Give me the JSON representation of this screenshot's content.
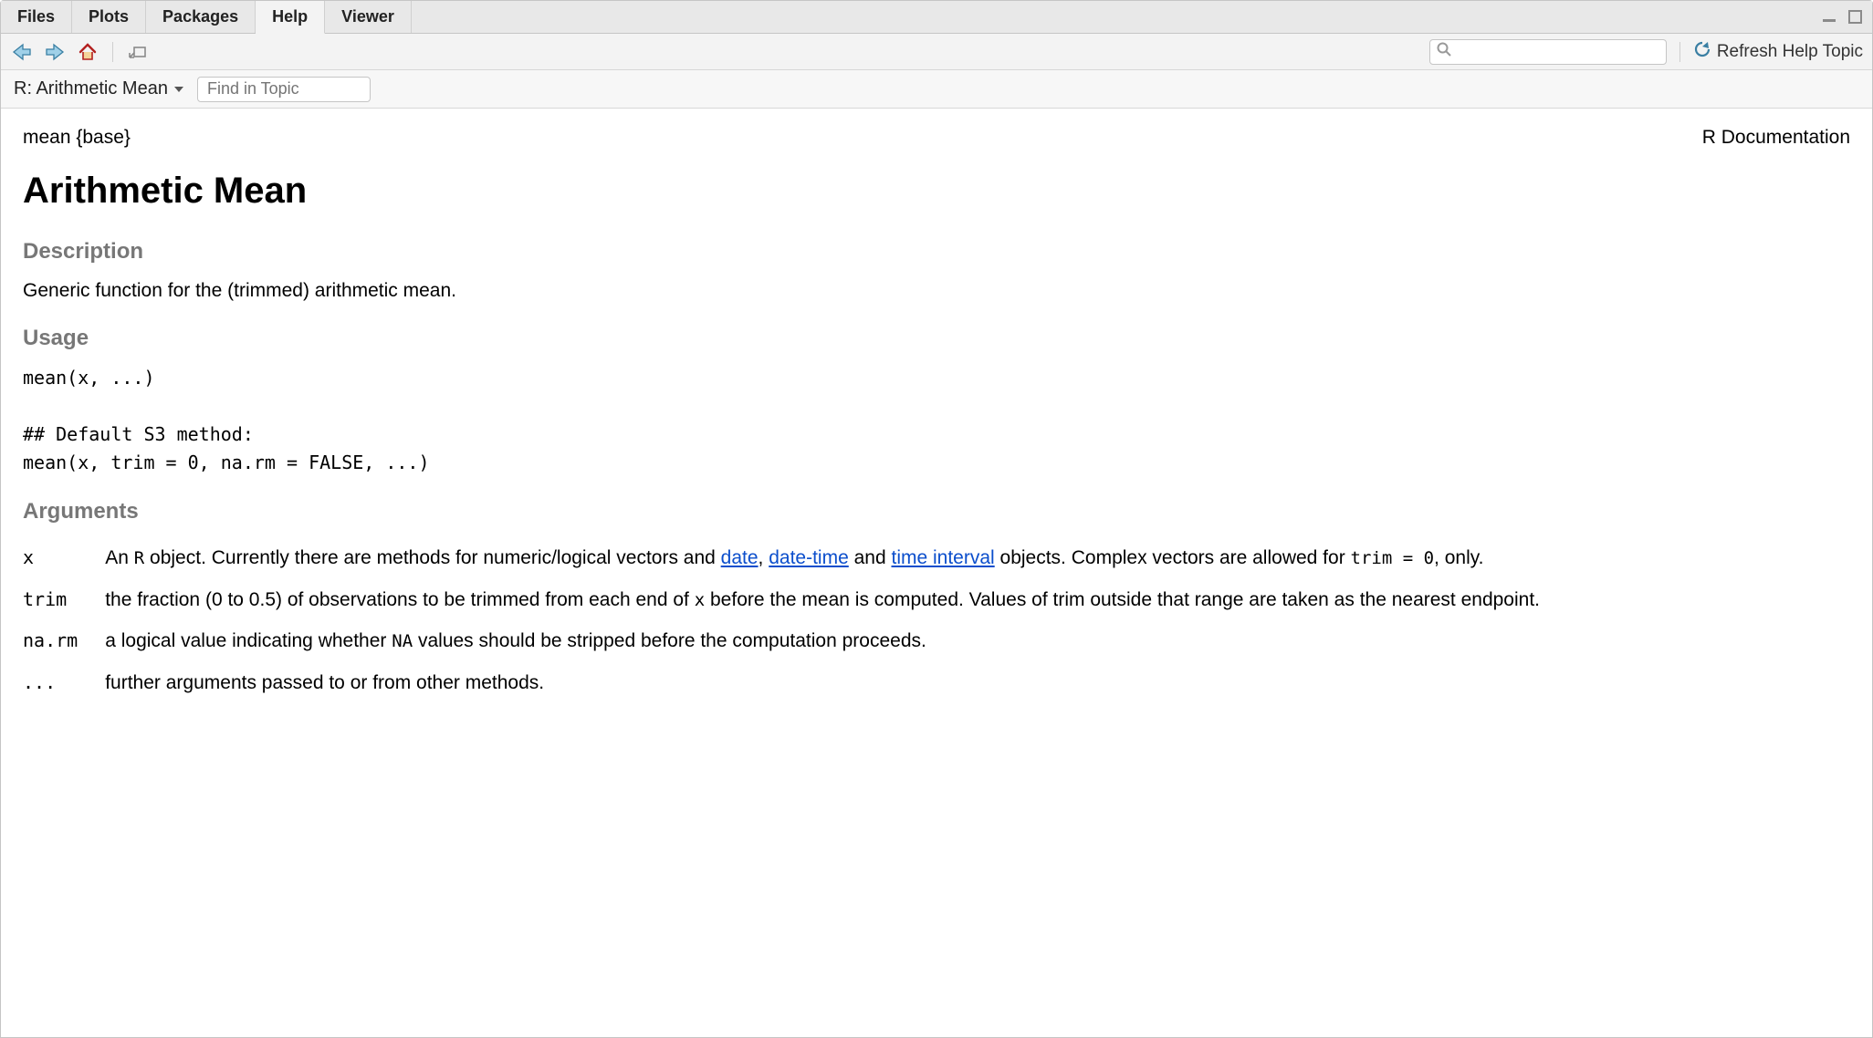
{
  "tabs": {
    "items": [
      "Files",
      "Plots",
      "Packages",
      "Help",
      "Viewer"
    ],
    "active_index": 3
  },
  "toolbar": {
    "search_placeholder": "",
    "refresh_label": "Refresh Help Topic"
  },
  "subbar": {
    "topic_label": "R: Arithmetic Mean",
    "find_placeholder": "Find in Topic"
  },
  "doc": {
    "pkgline": "mean {base}",
    "rightlabel": "R Documentation",
    "title": "Arithmetic Mean",
    "h_description": "Description",
    "description_text": "Generic function for the (trimmed) arithmetic mean.",
    "h_usage": "Usage",
    "usage_code": "mean(x, ...)\n\n## Default S3 method:\nmean(x, trim = 0, na.rm = FALSE, ...)",
    "h_arguments": "Arguments",
    "args": {
      "x": {
        "term": "x",
        "pre": "An ",
        "code1": "R",
        "mid1": " object. Currently there are methods for numeric/logical vectors and ",
        "link1": "date",
        "sep1": ", ",
        "link2": "date-time",
        "sep2": " and ",
        "link3": "time interval",
        "mid2": " objects. Complex vectors are allowed for ",
        "code2": "trim = 0",
        "post": ", only."
      },
      "trim": {
        "term": "trim",
        "pre": "the fraction (0 to 0.5) of observations to be trimmed from each end of ",
        "code1": "x",
        "post": " before the mean is computed. Values of trim outside that range are taken as the nearest endpoint."
      },
      "narm": {
        "term": "na.rm",
        "pre": "a logical value indicating whether ",
        "code1": "NA",
        "post": " values should be stripped before the computation proceeds."
      },
      "dots": {
        "term": "...",
        "text": "further arguments passed to or from other methods."
      }
    }
  }
}
